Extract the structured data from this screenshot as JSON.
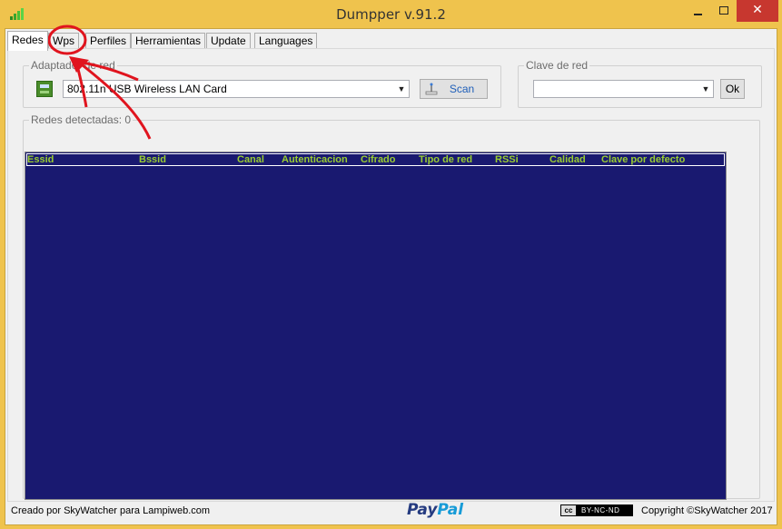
{
  "window": {
    "title": "Dumpper v.91.2",
    "minimize_label": "",
    "maximize_label": "",
    "close_label": "✕"
  },
  "tabs": [
    {
      "label": "Redes",
      "active": true
    },
    {
      "label": "Wps",
      "active": false
    },
    {
      "label": "Perfiles",
      "active": false
    },
    {
      "label": "Herramientas",
      "active": false
    },
    {
      "label": "Update",
      "active": false
    },
    {
      "label": "Languages",
      "active": false
    }
  ],
  "adapter_group": {
    "legend": "Adaptador de red",
    "selected_adapter": "802.11n USB Wireless LAN Card",
    "scan_label": "Scan"
  },
  "key_group": {
    "legend": "Clave de red",
    "selected_value": "",
    "ok_label": "Ok"
  },
  "networks_group": {
    "legend": "Redes detectadas: 0",
    "columns": [
      "Essid",
      "Bssid",
      "Canal",
      "Autenticacion",
      "Cifrado",
      "Tipo de red",
      "RSSi",
      "Calidad",
      "Clave por defecto"
    ],
    "rows": []
  },
  "footer": {
    "credit": "Creado por SkyWatcher para Lampiweb.com",
    "paypal_pay": "Pay",
    "paypal_pal": "Pal",
    "cc_symbol": "cc",
    "license": "BY-NC-ND",
    "copyright": "Copyright ©SkyWatcher 2017"
  },
  "colors": {
    "window_frame": "#EFC34D",
    "close_button": "#C7372F",
    "list_background": "#191970",
    "list_header_text": "#9ACD32",
    "annotation": "#E0141E"
  }
}
